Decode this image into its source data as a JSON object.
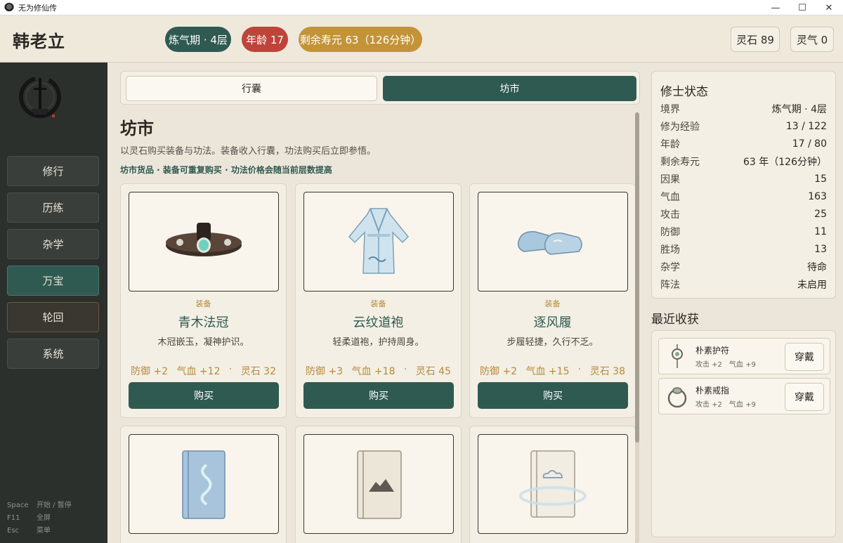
{
  "window": {
    "title": "无为修仙传",
    "minimize": "—",
    "maximize": "☐",
    "close": "✕"
  },
  "header": {
    "player_name": "韩老立",
    "realm": "炼气期 · 4层",
    "age": "年龄 17",
    "lifespan": "剩余寿元 63（126分钟）",
    "spirit_stone": "灵石 89",
    "spirit_qi": "灵气 0"
  },
  "sidebar": {
    "items": [
      {
        "label": "修行",
        "active": false
      },
      {
        "label": "历练",
        "active": false
      },
      {
        "label": "杂学",
        "active": false
      },
      {
        "label": "万宝",
        "active": true
      },
      {
        "label": "轮回",
        "active": false
      },
      {
        "label": "系统",
        "active": false
      }
    ],
    "hotkeys": [
      {
        "key": "Space",
        "action": "开始 / 暂停"
      },
      {
        "key": "F11",
        "action": "全屏"
      },
      {
        "key": "Esc",
        "action": "菜单"
      }
    ]
  },
  "tabs": {
    "bag": "行囊",
    "market": "坊市",
    "active": "market"
  },
  "market": {
    "title": "坊市",
    "description": "以灵石购买装备与功法。装备收入行囊，功法购买后立即参悟。",
    "note": "坊市货品 · 装备可重复购买 · 功法价格会随当前层数提高",
    "items": [
      {
        "type": "装备",
        "name": "青木法冠",
        "desc": "木冠嵌玉，凝神护识。",
        "stat1": "防御 +2",
        "stat2": "气血 +12",
        "sep": "·",
        "price": "灵石 32",
        "buy": "购买",
        "icon": "crown-icon"
      },
      {
        "type": "装备",
        "name": "云纹道袍",
        "desc": "轻柔道袍，护持周身。",
        "stat1": "防御 +3",
        "stat2": "气血 +18",
        "sep": "·",
        "price": "灵石 45",
        "buy": "购买",
        "icon": "robe-icon"
      },
      {
        "type": "装备",
        "name": "逐风履",
        "desc": "步履轻捷，久行不乏。",
        "stat1": "防御 +2",
        "stat2": "气血 +15",
        "sep": "·",
        "price": "灵石 38",
        "buy": "购买",
        "icon": "shoes-icon"
      },
      {
        "icon": "manual-blue-icon"
      },
      {
        "icon": "manual-mountain-icon"
      },
      {
        "icon": "manual-cloud-icon"
      }
    ]
  },
  "status": {
    "title": "修士状态",
    "rows": [
      {
        "label": "境界",
        "value": "炼气期 · 4层"
      },
      {
        "label": "修为经验",
        "value": "13 / 122"
      },
      {
        "label": "年龄",
        "value": "17 / 80"
      },
      {
        "label": "剩余寿元",
        "value": "63 年（126分钟）"
      },
      {
        "label": "因果",
        "value": "15"
      },
      {
        "label": "气血",
        "value": "163"
      },
      {
        "label": "攻击",
        "value": "25"
      },
      {
        "label": "防御",
        "value": "11"
      },
      {
        "label": "胜场",
        "value": "13"
      },
      {
        "label": "杂学",
        "value": "待命"
      },
      {
        "label": "阵法",
        "value": "未启用"
      }
    ]
  },
  "recent": {
    "title": "最近收获",
    "items": [
      {
        "name": "朴素护符",
        "stats": "攻击 +2　气血 +9",
        "button": "穿戴",
        "icon": "amulet-icon"
      },
      {
        "name": "朴素戒指",
        "stats": "攻击 +2　气血 +9",
        "button": "穿戴",
        "icon": "ring-icon"
      }
    ]
  },
  "colors": {
    "primary": "#2f5a52",
    "danger": "#c0433a",
    "gold": "#c39338",
    "sidebar_bg": "#2c302d",
    "panel_bg": "#f4efe4"
  }
}
